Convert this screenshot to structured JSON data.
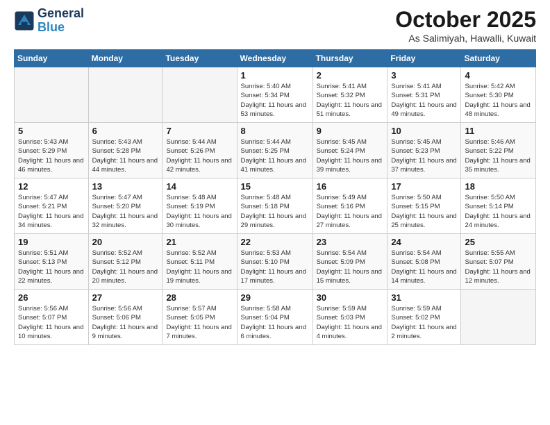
{
  "header": {
    "logo_line1": "General",
    "logo_line2": "Blue",
    "month": "October 2025",
    "location": "As Salimiyah, Hawalli, Kuwait"
  },
  "weekdays": [
    "Sunday",
    "Monday",
    "Tuesday",
    "Wednesday",
    "Thursday",
    "Friday",
    "Saturday"
  ],
  "weeks": [
    [
      {
        "day": "",
        "info": ""
      },
      {
        "day": "",
        "info": ""
      },
      {
        "day": "",
        "info": ""
      },
      {
        "day": "1",
        "info": "Sunrise: 5:40 AM\nSunset: 5:34 PM\nDaylight: 11 hours and 53 minutes."
      },
      {
        "day": "2",
        "info": "Sunrise: 5:41 AM\nSunset: 5:32 PM\nDaylight: 11 hours and 51 minutes."
      },
      {
        "day": "3",
        "info": "Sunrise: 5:41 AM\nSunset: 5:31 PM\nDaylight: 11 hours and 49 minutes."
      },
      {
        "day": "4",
        "info": "Sunrise: 5:42 AM\nSunset: 5:30 PM\nDaylight: 11 hours and 48 minutes."
      }
    ],
    [
      {
        "day": "5",
        "info": "Sunrise: 5:43 AM\nSunset: 5:29 PM\nDaylight: 11 hours and 46 minutes."
      },
      {
        "day": "6",
        "info": "Sunrise: 5:43 AM\nSunset: 5:28 PM\nDaylight: 11 hours and 44 minutes."
      },
      {
        "day": "7",
        "info": "Sunrise: 5:44 AM\nSunset: 5:26 PM\nDaylight: 11 hours and 42 minutes."
      },
      {
        "day": "8",
        "info": "Sunrise: 5:44 AM\nSunset: 5:25 PM\nDaylight: 11 hours and 41 minutes."
      },
      {
        "day": "9",
        "info": "Sunrise: 5:45 AM\nSunset: 5:24 PM\nDaylight: 11 hours and 39 minutes."
      },
      {
        "day": "10",
        "info": "Sunrise: 5:45 AM\nSunset: 5:23 PM\nDaylight: 11 hours and 37 minutes."
      },
      {
        "day": "11",
        "info": "Sunrise: 5:46 AM\nSunset: 5:22 PM\nDaylight: 11 hours and 35 minutes."
      }
    ],
    [
      {
        "day": "12",
        "info": "Sunrise: 5:47 AM\nSunset: 5:21 PM\nDaylight: 11 hours and 34 minutes."
      },
      {
        "day": "13",
        "info": "Sunrise: 5:47 AM\nSunset: 5:20 PM\nDaylight: 11 hours and 32 minutes."
      },
      {
        "day": "14",
        "info": "Sunrise: 5:48 AM\nSunset: 5:19 PM\nDaylight: 11 hours and 30 minutes."
      },
      {
        "day": "15",
        "info": "Sunrise: 5:48 AM\nSunset: 5:18 PM\nDaylight: 11 hours and 29 minutes."
      },
      {
        "day": "16",
        "info": "Sunrise: 5:49 AM\nSunset: 5:16 PM\nDaylight: 11 hours and 27 minutes."
      },
      {
        "day": "17",
        "info": "Sunrise: 5:50 AM\nSunset: 5:15 PM\nDaylight: 11 hours and 25 minutes."
      },
      {
        "day": "18",
        "info": "Sunrise: 5:50 AM\nSunset: 5:14 PM\nDaylight: 11 hours and 24 minutes."
      }
    ],
    [
      {
        "day": "19",
        "info": "Sunrise: 5:51 AM\nSunset: 5:13 PM\nDaylight: 11 hours and 22 minutes."
      },
      {
        "day": "20",
        "info": "Sunrise: 5:52 AM\nSunset: 5:12 PM\nDaylight: 11 hours and 20 minutes."
      },
      {
        "day": "21",
        "info": "Sunrise: 5:52 AM\nSunset: 5:11 PM\nDaylight: 11 hours and 19 minutes."
      },
      {
        "day": "22",
        "info": "Sunrise: 5:53 AM\nSunset: 5:10 PM\nDaylight: 11 hours and 17 minutes."
      },
      {
        "day": "23",
        "info": "Sunrise: 5:54 AM\nSunset: 5:09 PM\nDaylight: 11 hours and 15 minutes."
      },
      {
        "day": "24",
        "info": "Sunrise: 5:54 AM\nSunset: 5:08 PM\nDaylight: 11 hours and 14 minutes."
      },
      {
        "day": "25",
        "info": "Sunrise: 5:55 AM\nSunset: 5:07 PM\nDaylight: 11 hours and 12 minutes."
      }
    ],
    [
      {
        "day": "26",
        "info": "Sunrise: 5:56 AM\nSunset: 5:07 PM\nDaylight: 11 hours and 10 minutes."
      },
      {
        "day": "27",
        "info": "Sunrise: 5:56 AM\nSunset: 5:06 PM\nDaylight: 11 hours and 9 minutes."
      },
      {
        "day": "28",
        "info": "Sunrise: 5:57 AM\nSunset: 5:05 PM\nDaylight: 11 hours and 7 minutes."
      },
      {
        "day": "29",
        "info": "Sunrise: 5:58 AM\nSunset: 5:04 PM\nDaylight: 11 hours and 6 minutes."
      },
      {
        "day": "30",
        "info": "Sunrise: 5:59 AM\nSunset: 5:03 PM\nDaylight: 11 hours and 4 minutes."
      },
      {
        "day": "31",
        "info": "Sunrise: 5:59 AM\nSunset: 5:02 PM\nDaylight: 11 hours and 2 minutes."
      },
      {
        "day": "",
        "info": ""
      }
    ]
  ]
}
